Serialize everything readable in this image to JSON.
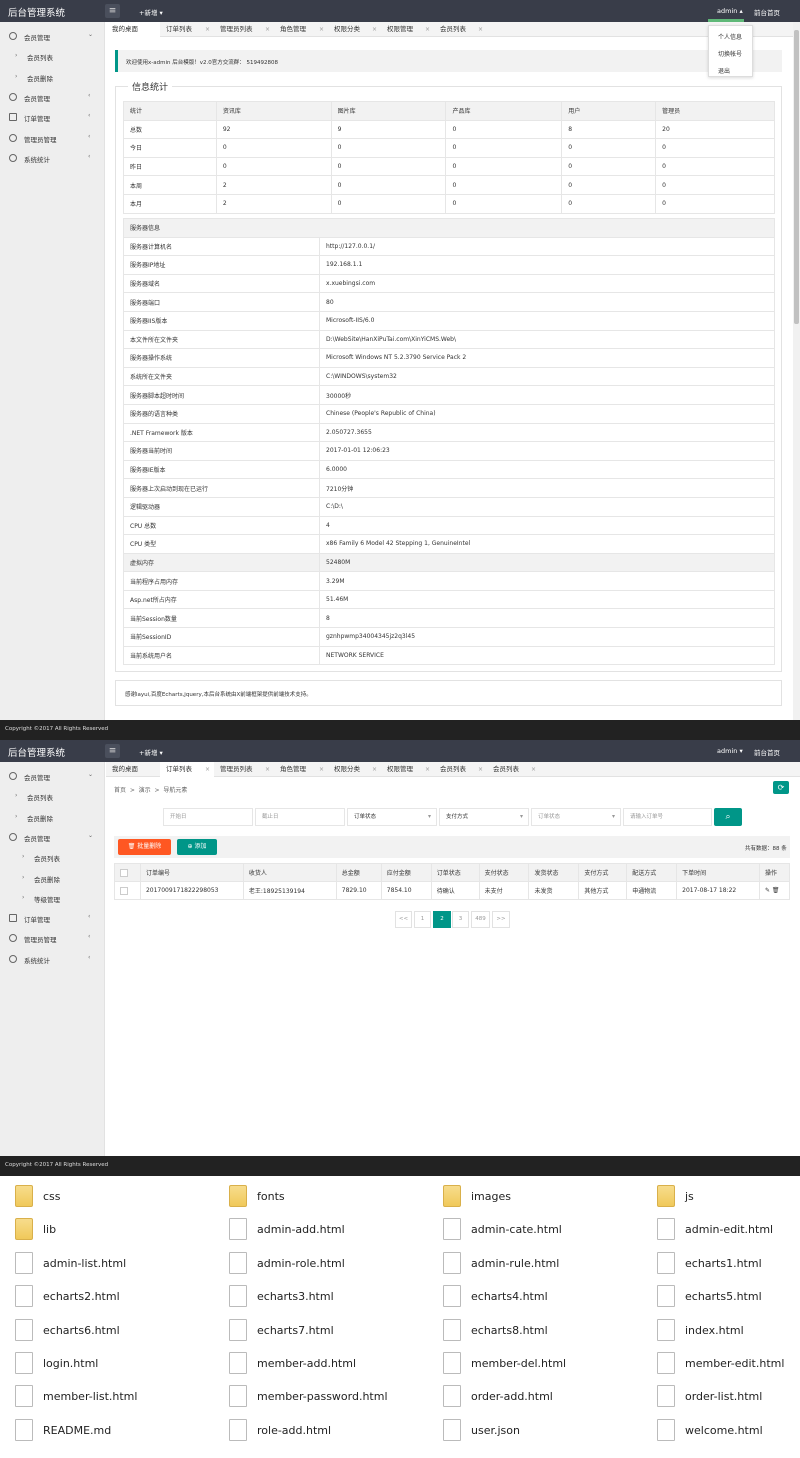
{
  "app": {
    "title": "后台管理系统",
    "new_label": "+新增 ▾",
    "admin_label": "admin",
    "front_label": "前台首页",
    "menu_icon": "menu-icon"
  },
  "user_menu": [
    "个人信息",
    "切换帐号",
    "退出"
  ],
  "sidebar1": [
    {
      "label": "会员管理",
      "icon": "user-icon",
      "arrow": "⌄"
    },
    {
      "label": "会员列表",
      "sub": true
    },
    {
      "label": "会员删除",
      "sub": true
    },
    {
      "label": "会员管理",
      "icon": "member-icon",
      "arrow": "‹"
    },
    {
      "label": "订单管理",
      "icon": "order-icon",
      "arrow": "‹"
    },
    {
      "label": "管理员管理",
      "icon": "admin-icon",
      "arrow": "‹"
    },
    {
      "label": "系统统计",
      "icon": "stats-icon",
      "arrow": "‹"
    }
  ],
  "tabs1": [
    "我的桌面",
    "订单列表",
    "管理员列表",
    "角色管理",
    "权限分类",
    "权限管理",
    "会员列表"
  ],
  "notice": "欢迎使用x-admin 后台模版！v2.0官方交流群： 519492808",
  "stats": {
    "legend": "信息统计",
    "headers": [
      "统计",
      "资讯库",
      "图片库",
      "产品库",
      "用户",
      "管理员"
    ],
    "rows": [
      [
        "总数",
        "92",
        "9",
        "0",
        "8",
        "20"
      ],
      [
        "今日",
        "0",
        "0",
        "0",
        "0",
        "0"
      ],
      [
        "昨日",
        "0",
        "0",
        "0",
        "0",
        "0"
      ],
      [
        "本周",
        "2",
        "0",
        "0",
        "0",
        "0"
      ],
      [
        "本月",
        "2",
        "0",
        "0",
        "0",
        "0"
      ]
    ]
  },
  "server": {
    "header": "服务器信息",
    "rows": [
      [
        "服务器计算机名",
        "http://127.0.0.1/"
      ],
      [
        "服务器IP地址",
        "192.168.1.1"
      ],
      [
        "服务器域名",
        "x.xuebingsi.com"
      ],
      [
        "服务器端口",
        "80"
      ],
      [
        "服务器IIS版本",
        "Microsoft-IIS/6.0"
      ],
      [
        "本文件所在文件夹",
        "D:\\WebSite\\HanXiPuTai.com\\XinYiCMS.Web\\"
      ],
      [
        "服务器操作系统",
        "Microsoft Windows NT 5.2.3790 Service Pack 2"
      ],
      [
        "系统所在文件夹",
        "C:\\WINDOWS\\system32"
      ],
      [
        "服务器脚本超时时间",
        "30000秒"
      ],
      [
        "服务器的语言种类",
        "Chinese (People's Republic of China)"
      ],
      [
        ".NET Framework 版本",
        "2.050727.3655"
      ],
      [
        "服务器当前时间",
        "2017-01-01 12:06:23"
      ],
      [
        "服务器IE版本",
        "6.0000"
      ],
      [
        "服务器上次启动到现在已运行",
        "7210分钟"
      ],
      [
        "逻辑驱动器",
        "C:\\D:\\"
      ],
      [
        "CPU 总数",
        "4"
      ],
      [
        "CPU 类型",
        "x86 Family 6 Model 42 Stepping 1, GenuineIntel"
      ],
      [
        "虚拟内存",
        "52480M"
      ],
      [
        "当前程序占用内存",
        "3.29M"
      ],
      [
        "Asp.net所占内存",
        "51.46M"
      ],
      [
        "当前Session数量",
        "8"
      ],
      [
        "当前SessionID",
        "gznhpwmp34004345jz2q3l45"
      ],
      [
        "当前系统用户名",
        "NETWORK SERVICE"
      ]
    ]
  },
  "thanks": "感谢layui,百度Echarts,jquery,本后台系统由X前端框架提供前端技术支持。",
  "footer": "Copyright ©2017 All Rights Reserved",
  "sidebar2": [
    {
      "label": "会员管理",
      "icon": "user-icon",
      "arrow": "⌄"
    },
    {
      "label": "会员列表",
      "sub": 1
    },
    {
      "label": "会员删除",
      "sub": 1
    },
    {
      "label": "会员管理",
      "icon": "member-icon",
      "arrow": "⌄"
    },
    {
      "label": "会员列表",
      "sub": 2
    },
    {
      "label": "会员删除",
      "sub": 2
    },
    {
      "label": "等级管理",
      "sub": 2
    },
    {
      "label": "订单管理",
      "icon": "order-icon",
      "arrow": "‹"
    },
    {
      "label": "管理员管理",
      "icon": "admin-icon",
      "arrow": "‹"
    },
    {
      "label": "系统统计",
      "icon": "stats-icon",
      "arrow": "‹"
    }
  ],
  "tabs2": [
    "我的桌面",
    "订单列表",
    "管理员列表",
    "角色管理",
    "权限分类",
    "权限管理",
    "会员列表",
    "会员列表"
  ],
  "breadcrumb": [
    "首页",
    "演示",
    "导航元素"
  ],
  "filters": {
    "start": "开始日",
    "end": "截止日",
    "order_status": "订单状态",
    "pay_method": "支付方式",
    "order_status2": "订单状态",
    "order_no": "请输入订单号"
  },
  "actions": {
    "batch_delete": "批量删除",
    "add": "添加",
    "total": "共有数据：88 条"
  },
  "orders": {
    "headers": [
      "",
      "订单编号",
      "收货人",
      "总金额",
      "应付金额",
      "订单状态",
      "支付状态",
      "发货状态",
      "支付方式",
      "配送方式",
      "下单时间",
      "操作"
    ],
    "rows": [
      [
        "",
        "2017009171822298053",
        "老王:18925139194",
        "7829.10",
        "7854.10",
        "待确认",
        "未支付",
        "未发货",
        "其他方式",
        "申通物流",
        "2017-08-17 18:22",
        "✎ 🗑"
      ]
    ]
  },
  "pager": [
    "<<",
    "1",
    "2",
    "3",
    "489",
    ">>"
  ],
  "pager_current": "2",
  "files": [
    {
      "name": "css",
      "type": "folder"
    },
    {
      "name": "fonts",
      "type": "folder"
    },
    {
      "name": "images",
      "type": "folder"
    },
    {
      "name": "js",
      "type": "folder"
    },
    {
      "name": "lib",
      "type": "folder"
    },
    {
      "name": "admin-add.html",
      "type": "file"
    },
    {
      "name": "admin-cate.html",
      "type": "file"
    },
    {
      "name": "admin-edit.html",
      "type": "file"
    },
    {
      "name": "admin-list.html",
      "type": "file"
    },
    {
      "name": "admin-role.html",
      "type": "file"
    },
    {
      "name": "admin-rule.html",
      "type": "file"
    },
    {
      "name": "echarts1.html",
      "type": "file"
    },
    {
      "name": "echarts2.html",
      "type": "file"
    },
    {
      "name": "echarts3.html",
      "type": "file"
    },
    {
      "name": "echarts4.html",
      "type": "file"
    },
    {
      "name": "echarts5.html",
      "type": "file"
    },
    {
      "name": "echarts6.html",
      "type": "file"
    },
    {
      "name": "echarts7.html",
      "type": "file"
    },
    {
      "name": "echarts8.html",
      "type": "file"
    },
    {
      "name": "index.html",
      "type": "file"
    },
    {
      "name": "login.html",
      "type": "file"
    },
    {
      "name": "member-add.html",
      "type": "file"
    },
    {
      "name": "member-del.html",
      "type": "file"
    },
    {
      "name": "member-edit.html",
      "type": "file"
    },
    {
      "name": "member-list.html",
      "type": "file"
    },
    {
      "name": "member-password.html",
      "type": "file"
    },
    {
      "name": "order-add.html",
      "type": "file"
    },
    {
      "name": "order-list.html",
      "type": "file"
    },
    {
      "name": "README.md",
      "type": "file"
    },
    {
      "name": "role-add.html",
      "type": "file"
    },
    {
      "name": "user.json",
      "type": "file"
    },
    {
      "name": "welcome.html",
      "type": "file"
    }
  ],
  "colors": {
    "accent": "#009688",
    "danger": "#ff5722",
    "topbar": "#393d49"
  }
}
